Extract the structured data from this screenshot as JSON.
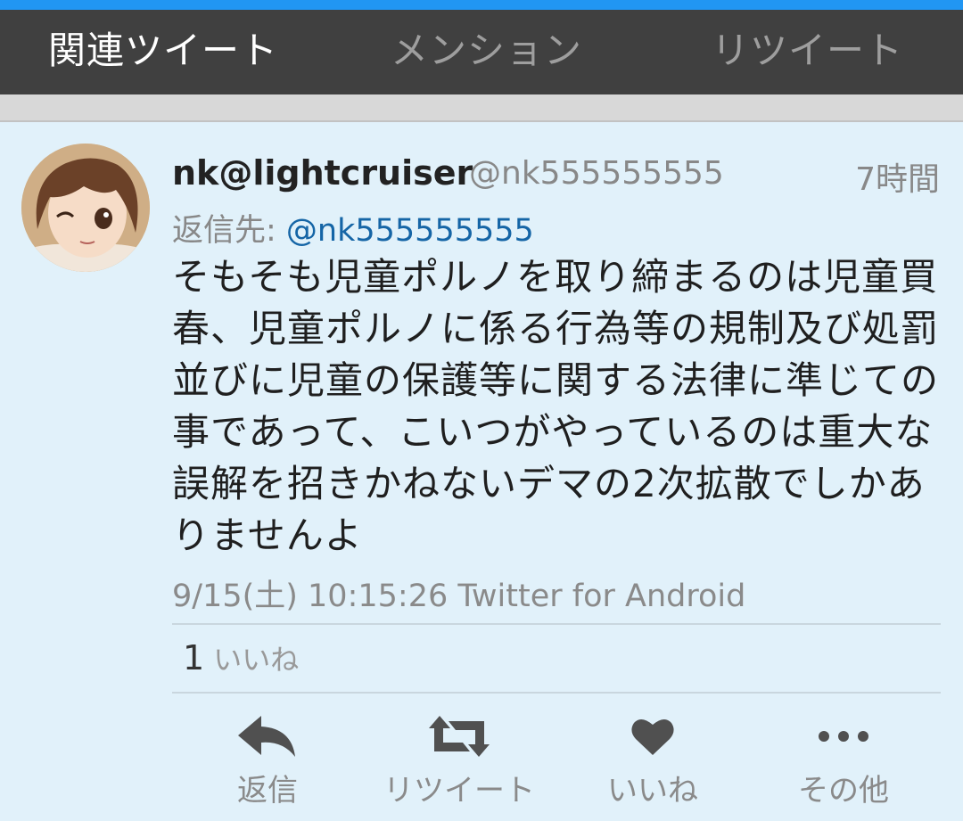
{
  "tabs": [
    {
      "label": "関連ツイート",
      "active": true
    },
    {
      "label": "メンション",
      "active": false
    },
    {
      "label": "リツイート",
      "active": false
    }
  ],
  "tweet": {
    "display_name": "nk@lightcruiser",
    "handle": "@nk555555555",
    "relative_time": "7時間",
    "reply_prefix": "返信先: ",
    "reply_to": "@nk555555555",
    "text": "そもそも児童ポルノを取り締まるのは児童買春、児童ポルノに係る行為等の規制及び処罰並びに児童の保護等に関する法律に準じての事であって、こいつがやっているのは重大な誤解を招きかねないデマの2次拡散でしかありませんよ",
    "timestamp_client": "9/15(土) 10:15:26 Twitter for Android",
    "like_count": "1",
    "like_label": "いいね"
  },
  "actions": [
    {
      "label": "返信",
      "icon": "reply-icon"
    },
    {
      "label": "リツイート",
      "icon": "retweet-icon"
    },
    {
      "label": "いいね",
      "icon": "heart-icon"
    },
    {
      "label": "その他",
      "icon": "more-icon"
    }
  ],
  "colors": {
    "tabbar": "#404040",
    "accent_line": "#2196f3",
    "background": "#e1f1fa",
    "link": "#1565a6"
  }
}
